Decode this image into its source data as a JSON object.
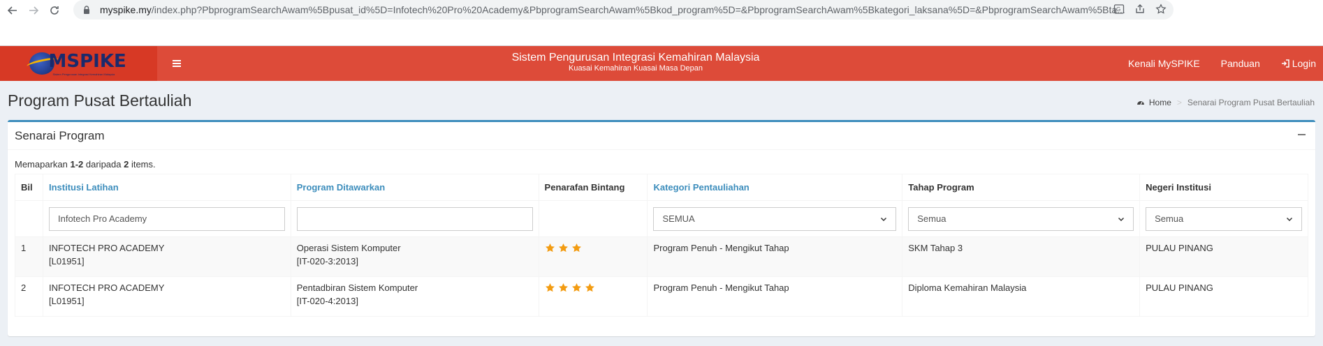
{
  "browser": {
    "url_host": "myspike.my",
    "url_rest": "/index.php?PbprogramSearchAwam%5Bpusat_id%5D=Infotech%20Pro%20Academy&PbprogramSearchAwam%5Bkod_program%5D=&PbprogramSearchAwam%5Bkategori_laksana%5D=&PbprogramSearchAwam%5Bta..."
  },
  "header": {
    "logo_text": "MSPIKE",
    "logo_subtitle": "Sistem Pengurusan Integrasi Kemahiran Malaysia",
    "title": "Sistem Pengurusan Integrasi Kemahiran Malaysia",
    "subtitle": "Kuasai Kemahiran Kuasai Masa Depan",
    "nav": [
      "Kenali MySPIKE",
      "Panduan",
      "Login"
    ]
  },
  "page": {
    "title": "Program Pusat Bertauliah",
    "breadcrumb_home": "Home",
    "breadcrumb_current": "Senarai Program Pusat Bertauliah"
  },
  "box": {
    "title": "Senarai Program",
    "summary_prefix": "Memaparkan ",
    "summary_range": "1-2",
    "summary_mid": " daripada ",
    "summary_total": "2",
    "summary_suffix": " items."
  },
  "table": {
    "columns": [
      "Bil",
      "Institusi Latihan",
      "Program Ditawarkan",
      "Penarafan Bintang",
      "Kategori Pentauliahan",
      "Tahap Program",
      "Negeri Institusi"
    ],
    "filters": {
      "institusi_value": "Infotech Pro Academy",
      "program_value": "",
      "kategori_selected": "SEMUA",
      "tahap_selected": "Semua",
      "negeri_selected": "Semua"
    },
    "rows": [
      {
        "bil": "1",
        "institusi": "INFOTECH PRO ACADEMY",
        "institusi_code": "[L01951]",
        "program": "Operasi Sistem Komputer",
        "program_code": "[IT-020-3:2013]",
        "stars": 3,
        "kategori": "Program Penuh - Mengikut Tahap",
        "tahap": "SKM Tahap 3",
        "negeri": "PULAU PINANG"
      },
      {
        "bil": "2",
        "institusi": "INFOTECH PRO ACADEMY",
        "institusi_code": "[L01951]",
        "program": "Pentadbiran Sistem Komputer",
        "program_code": "[IT-020-4:2013]",
        "stars": 4,
        "kategori": "Program Penuh - Mengikut Tahap",
        "tahap": "Diploma Kemahiran Malaysia",
        "negeri": "PULAU PINANG"
      }
    ]
  },
  "colors": {
    "header_bg": "#dd4b39",
    "logo_bg": "#d73925",
    "link": "#3c8dbc",
    "star": "#f39c12"
  }
}
